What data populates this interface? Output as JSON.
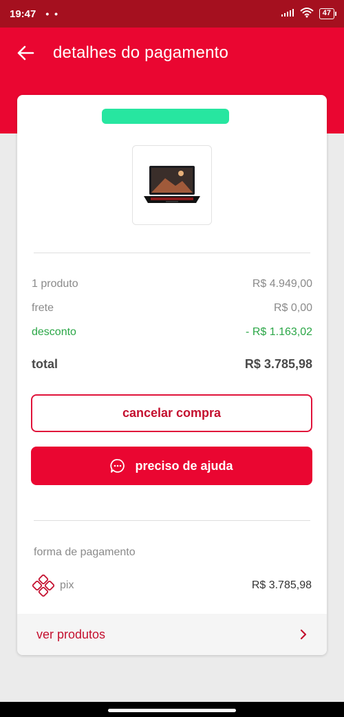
{
  "status_bar": {
    "time": "19:47",
    "dots": "• •",
    "battery": "47"
  },
  "header": {
    "title": "detalhes do pagamento"
  },
  "summary": {
    "products_label": "1 produto",
    "products_value": "R$ 4.949,00",
    "shipping_label": "frete",
    "shipping_value": "R$ 0,00",
    "discount_label": "desconto",
    "discount_value": "- R$ 1.163,02",
    "total_label": "total",
    "total_value": "R$ 3.785,98"
  },
  "actions": {
    "cancel_label": "cancelar compra",
    "help_label": "preciso de ajuda"
  },
  "payment": {
    "section_label": "forma de pagamento",
    "method": "pix",
    "amount": "R$ 3.785,98"
  },
  "footer": {
    "link_label": "ver produtos"
  },
  "colors": {
    "brand_red": "#ea0631",
    "status_bar": "#a5101f",
    "discount_green": "#2aa646",
    "redaction": "#27e6a0"
  },
  "icons": [
    "back-arrow-icon",
    "wifi-icon",
    "signal-icon",
    "chat-icon",
    "pix-icon",
    "chevron-right-icon"
  ]
}
